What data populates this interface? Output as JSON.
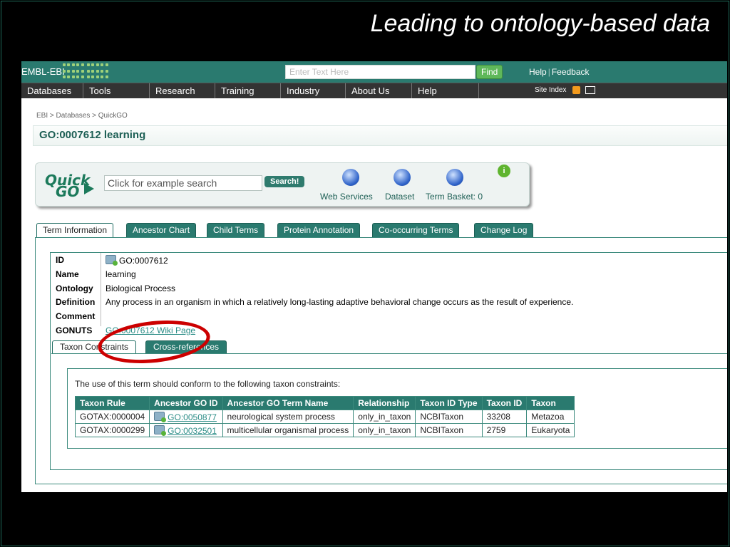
{
  "slide": {
    "title": "Leading to ontology-based data"
  },
  "ebi_header": {
    "logo_text": "EMBL-EBI",
    "search_placeholder": "Enter Text Here",
    "find_label": "Find",
    "help_label": "Help",
    "feedback_label": "Feedback"
  },
  "nav": {
    "items": [
      "Databases",
      "Tools",
      "Research",
      "Training",
      "Industry",
      "About Us",
      "Help"
    ],
    "site_index": "Site Index"
  },
  "breadcrumb": "EBI > Databases > QuickGO",
  "page_title": "GO:0007612 learning",
  "quickgo": {
    "logo_line1": "Quick",
    "logo_line2": "GO",
    "search_value": "Click for example search",
    "search_button": "Search!",
    "web_services": "Web Services",
    "dataset": "Dataset",
    "term_basket": "Term Basket: 0"
  },
  "tabs": [
    "Term Information",
    "Ancestor Chart",
    "Child Terms",
    "Protein Annotation",
    "Co-occurring Terms",
    "Change Log"
  ],
  "term": {
    "id_label": "ID",
    "id_value": "GO:0007612",
    "name_label": "Name",
    "name_value": "learning",
    "ontology_label": "Ontology",
    "ontology_value": "Biological Process",
    "definition_label": "Definition",
    "definition_value": "Any process in an organism in which a relatively long-lasting adaptive behavioral change occurs as the result of experience.",
    "comment_label": "Comment",
    "comment_value": "",
    "gonuts_label": "GONUTS",
    "gonuts_link": "GO:0007612 Wiki Page"
  },
  "subtabs": [
    "Taxon Constraints",
    "Cross-references"
  ],
  "taxon": {
    "intro": "The use of this term should conform to the following taxon constraints:",
    "headers": [
      "Taxon Rule",
      "Ancestor GO ID",
      "Ancestor GO Term Name",
      "Relationship",
      "Taxon ID Type",
      "Taxon ID",
      "Taxon"
    ],
    "rows": [
      [
        "GOTAX:0000004",
        "GO:0050877",
        "neurological system process",
        "only_in_taxon",
        "NCBITaxon",
        "33208",
        "Metazoa"
      ],
      [
        "GOTAX:0000299",
        "GO:0032501",
        "multicellular organismal process",
        "only_in_taxon",
        "NCBITaxon",
        "2759",
        "Eukaryota"
      ]
    ]
  }
}
